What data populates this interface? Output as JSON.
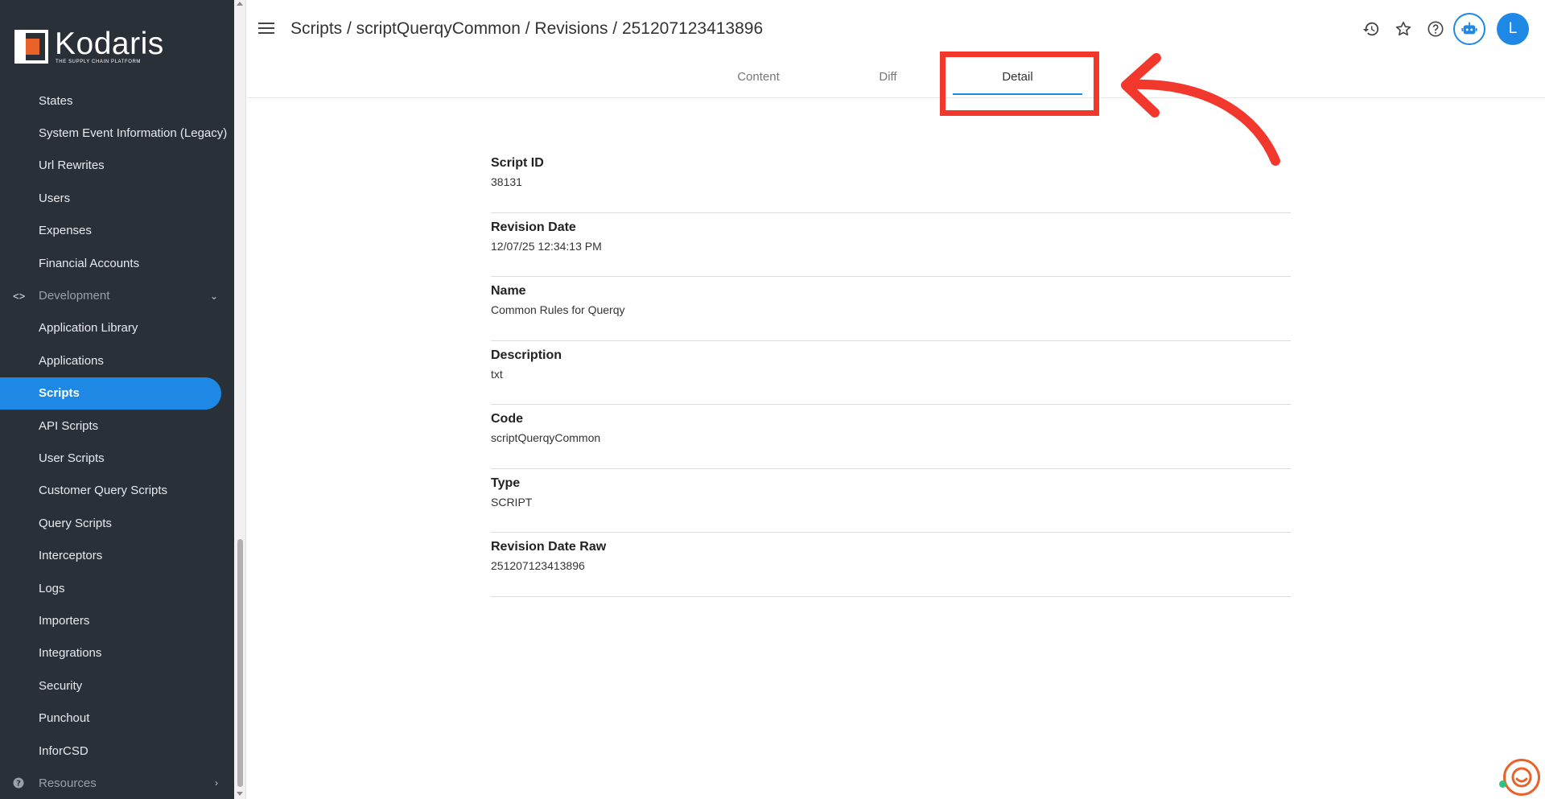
{
  "brand": {
    "name": "Kodaris",
    "tagline": "THE SUPPLY CHAIN PLATFORM",
    "accent": "#1e88e5",
    "logo_color": "#e8622a"
  },
  "sidebar": {
    "items": [
      {
        "label": "States",
        "active": false
      },
      {
        "label": "System Event Information (Legacy)",
        "active": false
      },
      {
        "label": "Url Rewrites",
        "active": false
      },
      {
        "label": "Users",
        "active": false
      },
      {
        "label": "Expenses",
        "active": false
      },
      {
        "label": "Financial Accounts",
        "active": false
      },
      {
        "label": "Development",
        "section": true,
        "icon": "code-icon",
        "chevron": "chevron-down-icon"
      },
      {
        "label": "Application Library",
        "active": false
      },
      {
        "label": "Applications",
        "active": false
      },
      {
        "label": "Scripts",
        "active": true
      },
      {
        "label": "API Scripts",
        "active": false
      },
      {
        "label": "User Scripts",
        "active": false
      },
      {
        "label": "Customer Query Scripts",
        "active": false
      },
      {
        "label": "Query Scripts",
        "active": false
      },
      {
        "label": "Interceptors",
        "active": false
      },
      {
        "label": "Logs",
        "active": false
      },
      {
        "label": "Importers",
        "active": false
      },
      {
        "label": "Integrations",
        "active": false
      },
      {
        "label": "Security",
        "active": false
      },
      {
        "label": "Punchout",
        "active": false
      },
      {
        "label": "InforCSD",
        "active": false
      },
      {
        "label": "Resources",
        "section": true,
        "icon": "help-circle-icon",
        "chevron": "chevron-right-icon"
      }
    ]
  },
  "header": {
    "breadcrumb": "Scripts / scriptQuerqyCommon / Revisions / 251207123413896",
    "avatar_initial": "L",
    "icons": [
      "history-icon",
      "star-icon",
      "help-icon",
      "bot-icon"
    ]
  },
  "tabs": [
    {
      "label": "Content",
      "active": false
    },
    {
      "label": "Diff",
      "active": false
    },
    {
      "label": "Detail",
      "active": true
    }
  ],
  "details": [
    {
      "label": "Script ID",
      "value": "38131"
    },
    {
      "label": "Revision Date",
      "value": "12/07/25 12:34:13 PM"
    },
    {
      "label": "Name",
      "value": "Common Rules for Querqy"
    },
    {
      "label": "Description",
      "value": "txt"
    },
    {
      "label": "Code",
      "value": "scriptQuerqyCommon"
    },
    {
      "label": "Type",
      "value": "SCRIPT"
    },
    {
      "label": "Revision Date Raw",
      "value": "251207123413896"
    }
  ],
  "annotation": {
    "color": "#f2382c"
  }
}
